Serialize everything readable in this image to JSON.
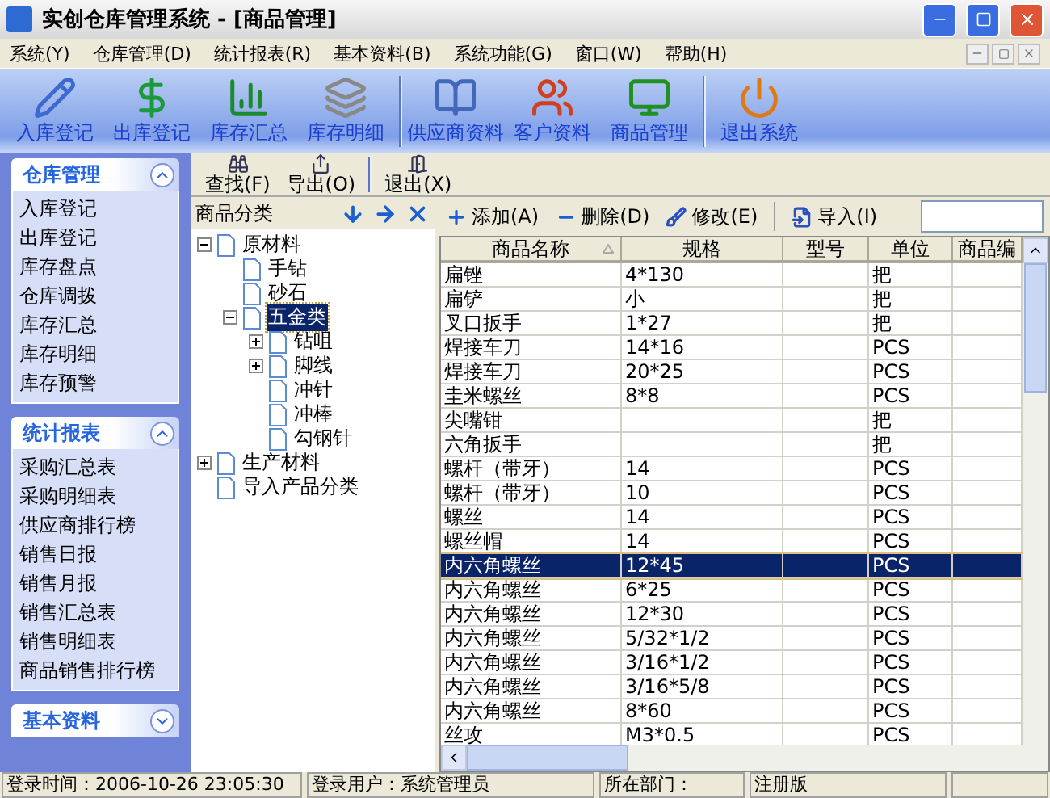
{
  "window": {
    "title": "实创仓库管理系统 - [商品管理]"
  },
  "menu": [
    "系统(Y)",
    "仓库管理(D)",
    "统计报表(R)",
    "基本资料(B)",
    "系统功能(G)",
    "窗口(W)",
    "帮助(H)"
  ],
  "toolbar": [
    {
      "label": "入库登记",
      "kind": "pencil"
    },
    {
      "label": "出库登记",
      "kind": "money"
    },
    {
      "label": "库存汇总",
      "kind": "chart"
    },
    {
      "label": "库存明细",
      "kind": "pages"
    },
    {
      "kind": "sep"
    },
    {
      "label": "供应商资料",
      "kind": "book"
    },
    {
      "label": "客户资料",
      "kind": "people"
    },
    {
      "label": "商品管理",
      "kind": "monitor"
    },
    {
      "kind": "sep"
    },
    {
      "label": "退出系统",
      "kind": "power"
    }
  ],
  "sidebar": [
    {
      "title": "仓库管理",
      "expanded": true,
      "items": [
        "入库登记",
        "出库登记",
        "库存盘点",
        "仓库调拨",
        "库存汇总",
        "库存明细",
        "库存预警"
      ]
    },
    {
      "title": "统计报表",
      "expanded": true,
      "items": [
        "采购汇总表",
        "采购明细表",
        "供应商排行榜",
        "销售日报",
        "销售月报",
        "销售汇总表",
        "销售明细表",
        "商品销售排行榜"
      ]
    },
    {
      "title": "基本资料",
      "expanded": false
    }
  ],
  "subtoolbar": [
    {
      "label": "查找(F)",
      "kind": "find"
    },
    {
      "label": "导出(O)",
      "kind": "export"
    },
    {
      "kind": "sep"
    },
    {
      "label": "退出(X)",
      "kind": "exit"
    }
  ],
  "tree": {
    "title": "商品分类",
    "nodes": [
      {
        "label": "原材料",
        "expanded": true,
        "selected": false,
        "children": [
          {
            "label": "手钻",
            "selected": false
          },
          {
            "label": "砂石",
            "selected": false
          },
          {
            "label": "五金类",
            "expanded": true,
            "selected": true,
            "children": [
              {
                "label": "钻咀",
                "expanded": false,
                "selected": false
              },
              {
                "label": "脚线",
                "expanded": false,
                "selected": false
              },
              {
                "label": "冲针",
                "selected": false
              },
              {
                "label": "冲棒",
                "selected": false
              },
              {
                "label": "勾钢针",
                "selected": false
              }
            ]
          }
        ]
      },
      {
        "label": "生产材料",
        "expanded": false,
        "selected": false
      },
      {
        "label": "导入产品分类",
        "selected": false
      }
    ]
  },
  "grid_toolbar": [
    {
      "label": "添加(A)",
      "kind": "add"
    },
    {
      "label": "删除(D)",
      "kind": "remove"
    },
    {
      "label": "修改(E)",
      "kind": "edit"
    },
    {
      "kind": "sep"
    },
    {
      "label": "导入(I)",
      "kind": "import"
    }
  ],
  "table": {
    "columns": [
      {
        "label": "商品名称",
        "sorted": true
      },
      {
        "label": "规格",
        "sorted": false
      },
      {
        "label": "型号",
        "sorted": false
      },
      {
        "label": "单位",
        "sorted": false
      },
      {
        "label": "商品编",
        "sorted": false
      }
    ],
    "rows": [
      {
        "cells": [
          "扁锉",
          "4*130",
          "",
          "把",
          ""
        ],
        "selected": false
      },
      {
        "cells": [
          "扁铲",
          "小",
          "",
          "把",
          ""
        ],
        "selected": false
      },
      {
        "cells": [
          "叉口扳手",
          "1*27",
          "",
          "把",
          ""
        ],
        "selected": false
      },
      {
        "cells": [
          "焊接车刀",
          "14*16",
          "",
          "PCS",
          ""
        ],
        "selected": false
      },
      {
        "cells": [
          "焊接车刀",
          "20*25",
          "",
          "PCS",
          ""
        ],
        "selected": false
      },
      {
        "cells": [
          "圭米螺丝",
          "8*8",
          "",
          "PCS",
          ""
        ],
        "selected": false
      },
      {
        "cells": [
          "尖嘴钳",
          "",
          "",
          "把",
          ""
        ],
        "selected": false
      },
      {
        "cells": [
          "六角扳手",
          "",
          "",
          "把",
          ""
        ],
        "selected": false
      },
      {
        "cells": [
          "螺杆（带牙）",
          "14",
          "",
          "PCS",
          ""
        ],
        "selected": false
      },
      {
        "cells": [
          "螺杆（带牙）",
          "10",
          "",
          "PCS",
          ""
        ],
        "selected": false
      },
      {
        "cells": [
          "螺丝",
          "14",
          "",
          "PCS",
          ""
        ],
        "selected": false
      },
      {
        "cells": [
          "螺丝帽",
          "14",
          "",
          "PCS",
          ""
        ],
        "selected": false
      },
      {
        "cells": [
          "内六角螺丝",
          "12*45",
          "",
          "PCS",
          ""
        ],
        "selected": true
      },
      {
        "cells": [
          "内六角螺丝",
          "6*25",
          "",
          "PCS",
          ""
        ],
        "selected": false
      },
      {
        "cells": [
          "内六角螺丝",
          "12*30",
          "",
          "PCS",
          ""
        ],
        "selected": false
      },
      {
        "cells": [
          "内六角螺丝",
          "5/32*1/2",
          "",
          "PCS",
          ""
        ],
        "selected": false
      },
      {
        "cells": [
          "内六角螺丝",
          "3/16*1/2",
          "",
          "PCS",
          ""
        ],
        "selected": false
      },
      {
        "cells": [
          "内六角螺丝",
          "3/16*5/8",
          "",
          "PCS",
          ""
        ],
        "selected": false
      },
      {
        "cells": [
          "内六角螺丝",
          "8*60",
          "",
          "PCS",
          ""
        ],
        "selected": false
      },
      {
        "cells": [
          "丝攻",
          "M3*0.5",
          "",
          "PCS",
          ""
        ],
        "selected": false
      }
    ]
  },
  "status_bar": [
    "登录时间：2006-10-26 23:05:30",
    "登录用户：系统管理员",
    "所在部门：",
    "注册版"
  ]
}
